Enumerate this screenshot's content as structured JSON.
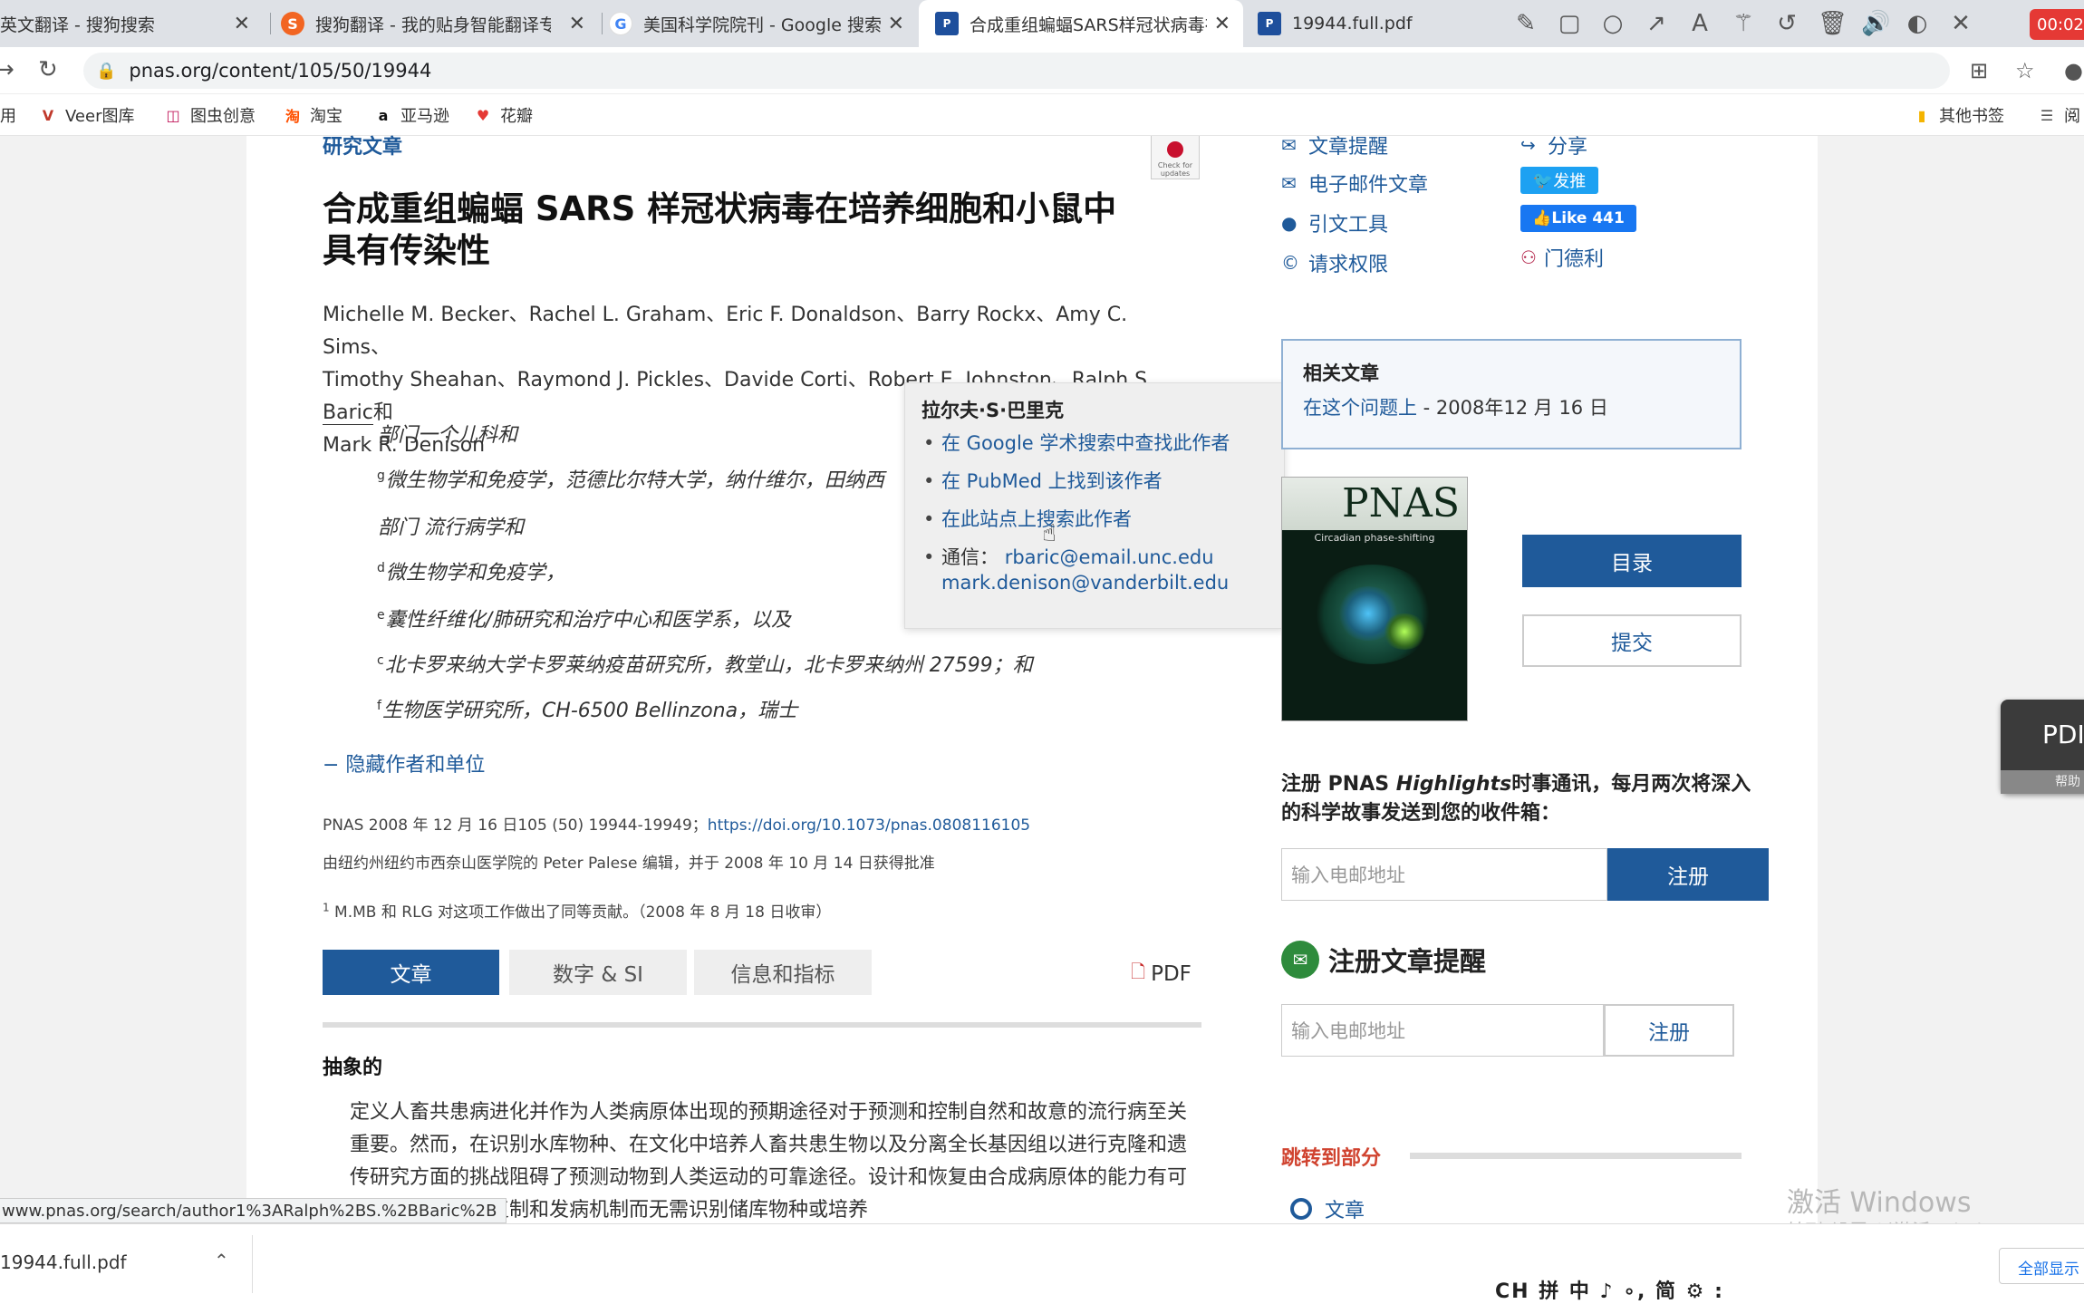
{
  "browser": {
    "tabs": [
      {
        "title": "英文翻译 - 搜狗搜索",
        "icon": "sogou-icon"
      },
      {
        "title": "搜狗翻译 - 我的贴身智能翻译专",
        "icon": "sogou-icon"
      },
      {
        "title": "美国科学院院刊 - Google 搜索",
        "icon": "google-icon"
      },
      {
        "title": "合成重组蝙蝠SARS样冠状病毒在",
        "icon": "pnas-icon"
      },
      {
        "title": "19944.full.pdf",
        "icon": "pnas-icon"
      }
    ],
    "recording_time": "00:02:",
    "url": "pnas.org/content/105/50/19944",
    "bookmarks": [
      "用",
      "Veer图库",
      "图虫创意",
      "淘宝",
      "亚马逊",
      "花瓣"
    ],
    "bookmarks_right": [
      "其他书签",
      "阅"
    ]
  },
  "article": {
    "section_label": "研究文章",
    "crossmark_text": "Check for updates",
    "title": "合成重组蝙蝠 SARS 样冠状病毒在培养细胞和小鼠中具有传染性",
    "authors_line1": "Michelle M. Becker、Rachel L. Graham、Eric F. Donaldson、Barry Rockx、Amy C. Sims、",
    "authors_line2a": "Timothy Sheahan、Raymond J. Pickles、Davide Corti、Robert E. Johnston、",
    "authors_line2_highlight": "Ralph S. Baric",
    "authors_line2b": "和",
    "authors_line3": "Mark R. Denison",
    "affiliations": [
      {
        "sup": "",
        "text": "部门一个儿科和"
      },
      {
        "sup": "g",
        "text": "微生物学和免疫学，范德比尔特大学，纳什维尔，田纳西"
      },
      {
        "sup": "",
        "text": "部门 流行病学和"
      },
      {
        "sup": "d",
        "text": "微生物学和免疫学，"
      },
      {
        "sup": "e",
        "text": "囊性纤维化/肺研究和治疗中心和医学系，以及"
      },
      {
        "sup": "c",
        "text": "北卡罗来纳大学卡罗莱纳疫苗研究所，教堂山，北卡罗来纳州 27599；和"
      },
      {
        "sup": "f",
        "text": "生物医学研究所，CH-6500 Bellinzona，瑞士"
      }
    ],
    "hide_authors": "− 隐藏作者和单位",
    "citation": "PNAS 2008 年 12 月 16 日105 (50) 19944-19949；",
    "doi": "https://doi.org/10.1073/pnas.0808116105",
    "edited_by": "由纽约州纽约市西奈山医学院的 Peter Palese 编辑，并于 2008 年 10 月 14 日获得批准",
    "footnote_sup": "1",
    "footnote": "M.MB 和 RLG 对这项工作做出了同等贡献。（2008 年 8 月 18 日收审）",
    "tabs": [
      "文章",
      "数字 & SI",
      "信息和指标"
    ],
    "pdf_label": "PDF",
    "abstract_heading": "抽象的",
    "abstract_text": "定义人畜共患病进化并作为人类病原体出现的预期途径对于预测和控制自然和故意的流行病至关重要。然而，在识别水库物种、在文化中培养人畜共患生物以及分离全长基因组以进行克隆和遗传研究方面的挑战阻碍了预测动物到人类运动的可靠途径。设计和恢复由合成病原体的能力有可能通过允许研究复制和发病机制而无需识别储库物种或培养"
  },
  "author_popup": {
    "name": "拉尔夫·S·巴里克",
    "links": [
      "在 Google 学术搜索中查找此作者",
      "在 PubMed 上找到该作者",
      "在此站点上搜索此作者"
    ],
    "correspondence_label": "通信：",
    "emails": [
      "rbaric@email.unc.edu",
      "mark.denison@vanderbilt.edu"
    ]
  },
  "sidebar": {
    "tools": [
      "文章提醒",
      "电子邮件文章",
      "引文工具",
      "请求权限"
    ],
    "share_label": "分享",
    "tweet_label": "发推",
    "like_label": "Like 441",
    "mendeley_label": "门德利",
    "related_heading": "相关文章",
    "related_link": "在这个问题上",
    "related_date": " - 2008年12 月 16 日",
    "cover_title": "PNAS",
    "cover_subtitle": "Circadian phase-shifting",
    "toc_button": "目录",
    "submit_button": "提交",
    "highlights_text_pre": "注册 PNAS ",
    "highlights_text_em": "Highlights",
    "highlights_text_post": "时事通讯，每月两次将深入的科学故事发送到您的收件箱：",
    "email_placeholder": "输入电邮地址",
    "signup_button": "注册",
    "alert_heading": "注册文章提醒",
    "jump_heading": "跳转到部分",
    "jump_item": "文章"
  },
  "overlays": {
    "pdf_widget_label": "PDI",
    "pdf_widget_help": "帮助",
    "watermark_line1": "激活 Windows",
    "watermark_line2": "转到\"设置\"以激活 Windows。",
    "status_url": "www.pnas.org/search/author1%3ARalph%2BS.%2BBaric%2B",
    "download_file": "19944.full.pdf",
    "ime_text": "CH 拼 中 ♪ ∘, 简 ⚙ :",
    "show_all": "全部显示"
  },
  "colors": {
    "accent": "#1f5a9a",
    "jump": "#d0432f",
    "tab_active": "#1f5a9a"
  }
}
